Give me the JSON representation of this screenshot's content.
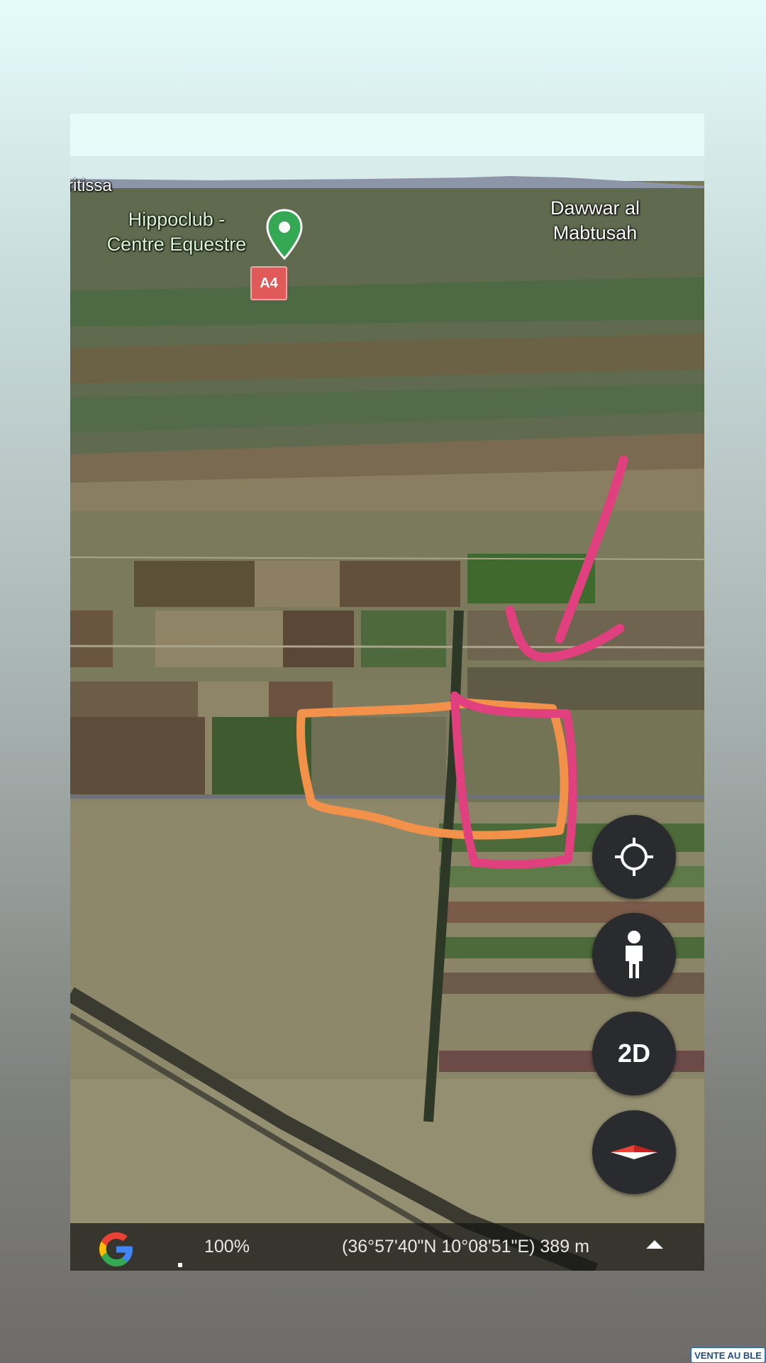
{
  "map": {
    "place_labels": {
      "tritissa": "ritissa",
      "hippoclub_line1": "Hippoclub -",
      "hippoclub_line2": "Centre Equestre",
      "dawwar_line1": "Dawwar al",
      "dawwar_line2": "Mabtusah"
    },
    "road_badge": "A4",
    "pin_color": "#34a853",
    "annotation_colors": {
      "orange_outline": "#f2914a",
      "pink_outline": "#e0407e",
      "pink_arrow": "#e0407e"
    }
  },
  "controls": {
    "locate_icon": "crosshair-icon",
    "street_view_icon": "person-icon",
    "view_mode_label": "2D",
    "compass_icon": "compass-icon"
  },
  "status_bar": {
    "logo": "google-logo",
    "zoom": "100%",
    "coordinates": "(36°57'40\"N 10°08'51\"E) 389 m",
    "expand_icon": "chevron-up-icon"
  },
  "watermark": "VENTE AU BLE"
}
